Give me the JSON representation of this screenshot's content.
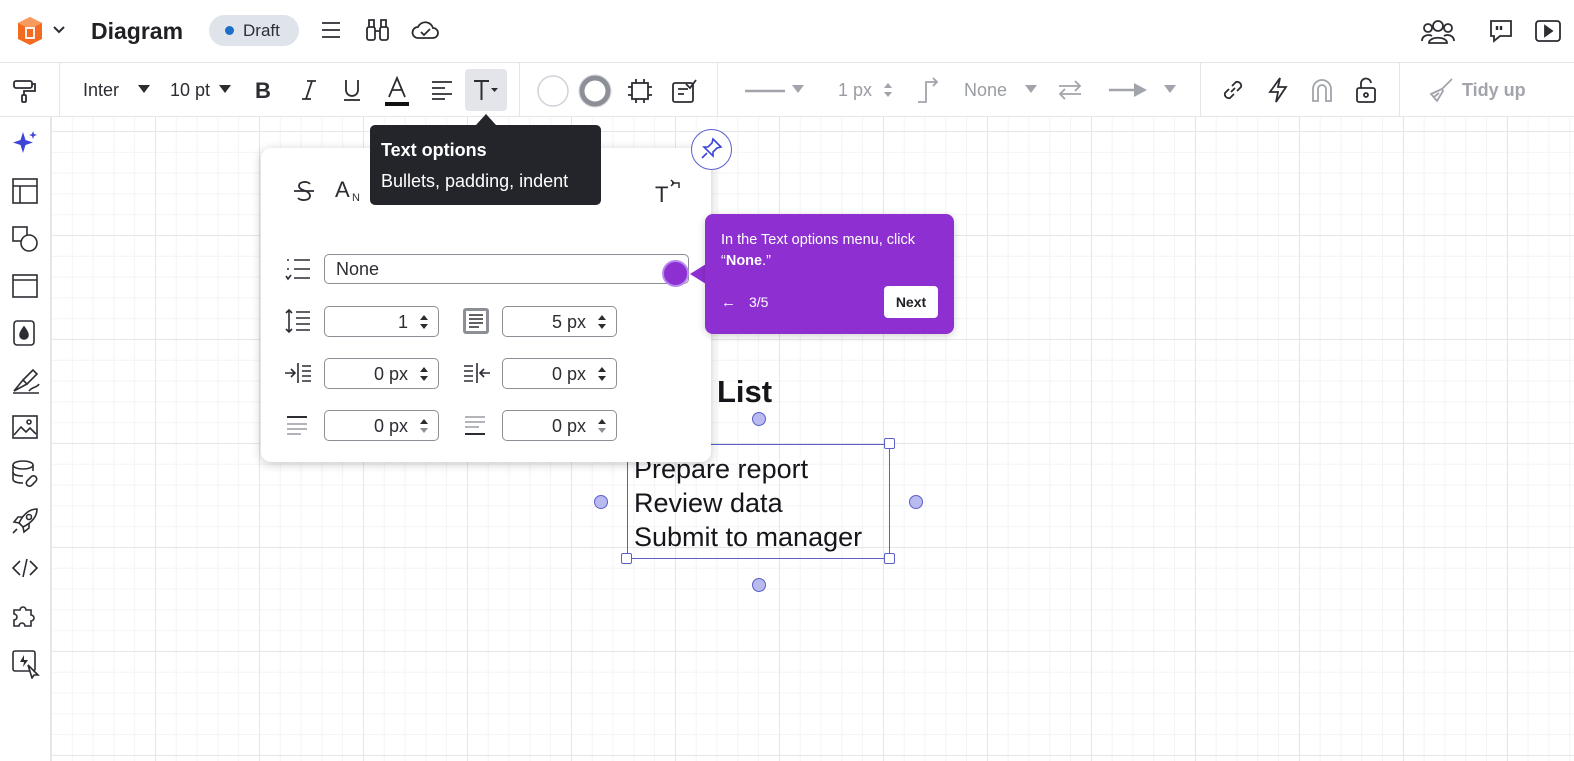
{
  "header": {
    "doc_title": "Diagram",
    "status_badge": "Draft"
  },
  "toolbar": {
    "font_family": "Inter",
    "font_size": "10 pt",
    "line_width": "1 px",
    "line_end": "None",
    "tidy_up": "Tidy up"
  },
  "tooltip": {
    "title": "Text options",
    "subtitle": "Bullets, padding, indent"
  },
  "text_panel": {
    "bullet_style": "None",
    "line_spacing": "1",
    "text_padding": "5 px",
    "indent_left": "0 px",
    "indent_right": "0 px",
    "space_before": "0 px",
    "space_after": "0 px"
  },
  "guide": {
    "message_prefix": "In the Text options menu, click",
    "message_highlight": "None",
    "back_label": "←",
    "step": "3/5",
    "next_label": "Next"
  },
  "canvas": {
    "list_title": "List",
    "list_items": [
      "Prepare report",
      "Review data",
      "Submit to manager"
    ]
  },
  "colors": {
    "accent_purple": "#8e2fd1",
    "selection_blue": "#5b5fc7",
    "draft_dot": "#1b6fc9",
    "logo_orange": "#f26b21"
  }
}
